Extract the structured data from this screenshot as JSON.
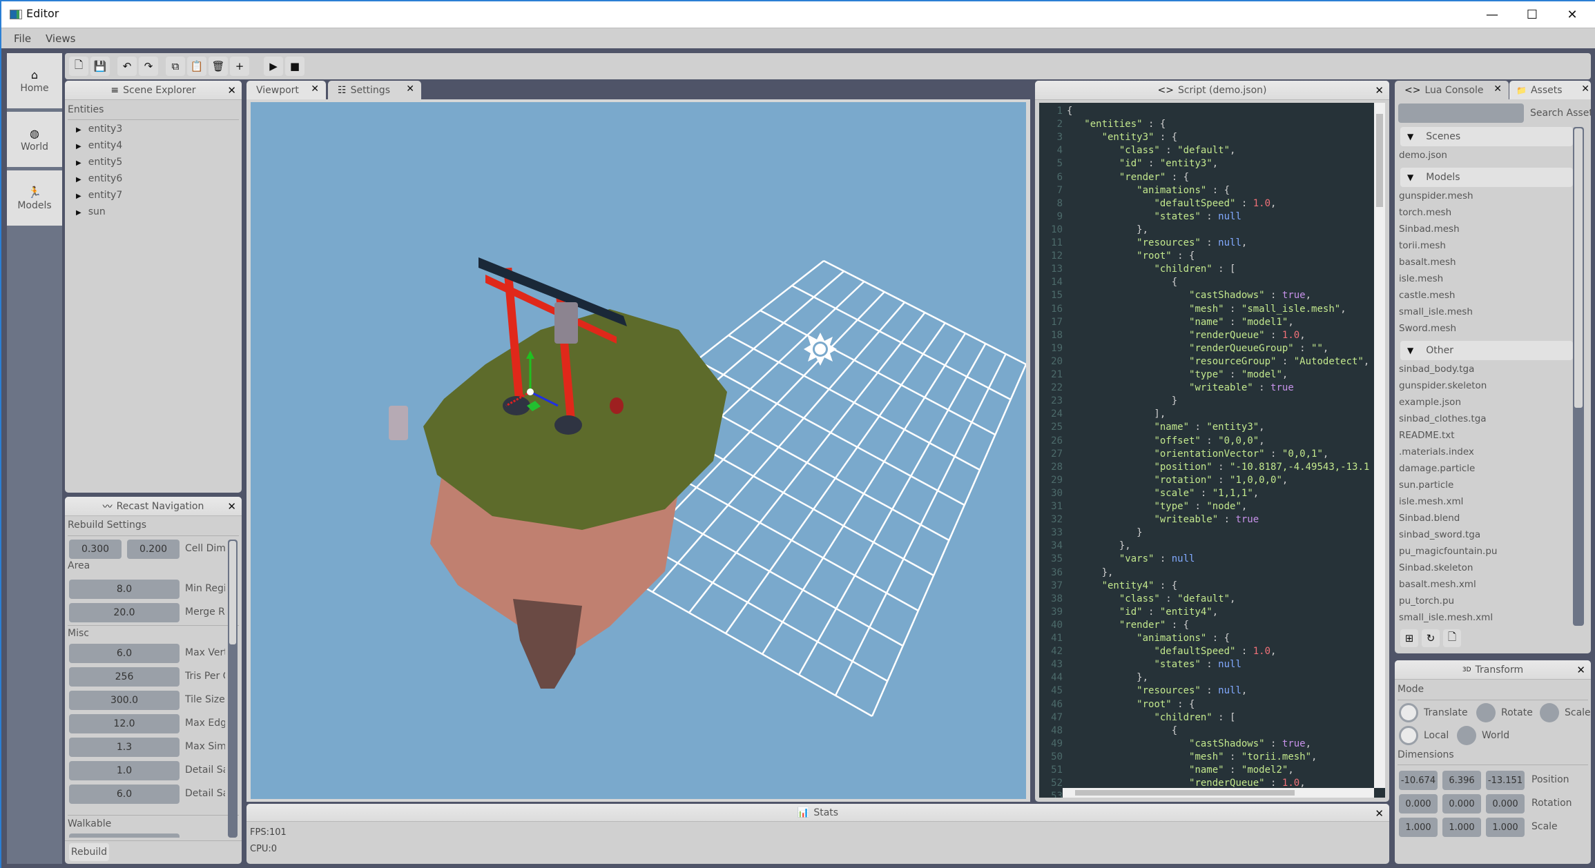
{
  "window": {
    "title": "Editor",
    "controls": {
      "minimize": "—",
      "maximize": "☐",
      "close": "✕"
    }
  },
  "menu": {
    "items": [
      "File",
      "Views"
    ]
  },
  "toolbar": {
    "buttons": [
      {
        "name": "new-file",
        "glyph": "🗋"
      },
      {
        "name": "save",
        "glyph": "💾"
      },
      {
        "name": "undo",
        "glyph": "↶"
      },
      {
        "name": "redo",
        "glyph": "↷"
      },
      {
        "name": "copy",
        "glyph": "⧉"
      },
      {
        "name": "paste",
        "glyph": "📋"
      },
      {
        "name": "delete",
        "glyph": "🗑"
      },
      {
        "name": "add",
        "glyph": "+"
      },
      {
        "name": "play",
        "glyph": "▶"
      },
      {
        "name": "stop",
        "glyph": "■"
      }
    ]
  },
  "sidebar": {
    "items": [
      {
        "label": "Home",
        "icon": "⌂"
      },
      {
        "label": "World",
        "icon": "◍"
      },
      {
        "label": "Models",
        "icon": "🏃"
      }
    ]
  },
  "scene_explorer": {
    "title": "Scene Explorer",
    "icon": "≡",
    "section": "Entities",
    "entities": [
      "entity3",
      "entity4",
      "entity5",
      "entity6",
      "entity7",
      "sun"
    ]
  },
  "recast": {
    "title": "Recast Navigation",
    "icon": "〰",
    "section": "Rebuild Settings",
    "cell_dimensions": {
      "values": [
        "0.300",
        "0.200"
      ],
      "label": "Cell Dimensions"
    },
    "area": {
      "label": "Area",
      "fields": [
        {
          "value": "8.0",
          "label": "Min Region"
        },
        {
          "value": "20.0",
          "label": "Merge Region"
        }
      ]
    },
    "misc": {
      "label": "Misc",
      "fields": [
        {
          "value": "6.0",
          "label": "Max Verts"
        },
        {
          "value": "256",
          "label": "Tris Per Chunk"
        },
        {
          "value": "300.0",
          "label": "Tile Size"
        },
        {
          "value": "12.0",
          "label": "Max Edge"
        },
        {
          "value": "1.3",
          "label": "Max Simplification"
        },
        {
          "value": "1.0",
          "label": "Detail Sample Dist"
        },
        {
          "value": "6.0",
          "label": "Detail Sample Max Error"
        }
      ]
    },
    "walkable": {
      "label": "Walkable"
    },
    "rebuild_button": "Rebuild"
  },
  "center_tabs": [
    {
      "label": "Viewport",
      "icon": "",
      "active": true
    },
    {
      "label": "Settings",
      "icon": "☷",
      "active": false
    }
  ],
  "viewport": {
    "sky_color": "#7aa9cc",
    "grid_color": "#ffffff",
    "gizmo_colors": {
      "x": "#e02020",
      "y": "#20c020",
      "z": "#2030e0"
    }
  },
  "stats": {
    "title": "Stats",
    "icon": "📊",
    "fps": "FPS:101",
    "cpu": "CPU:0"
  },
  "script": {
    "title": "Script (demo.json)",
    "icon": "<>",
    "lines": [
      [
        [
          "p",
          "{"
        ]
      ],
      [
        [
          "p",
          "   "
        ],
        [
          "k",
          "\"entities\""
        ],
        [
          "p",
          " : {"
        ]
      ],
      [
        [
          "p",
          "      "
        ],
        [
          "k",
          "\"entity3\""
        ],
        [
          "p",
          " : {"
        ]
      ],
      [
        [
          "p",
          "         "
        ],
        [
          "k",
          "\"class\""
        ],
        [
          "p",
          " : "
        ],
        [
          "s",
          "\"default\""
        ],
        [
          "p",
          ","
        ]
      ],
      [
        [
          "p",
          "         "
        ],
        [
          "k",
          "\"id\""
        ],
        [
          "p",
          " : "
        ],
        [
          "s",
          "\"entity3\""
        ],
        [
          "p",
          ","
        ]
      ],
      [
        [
          "p",
          "         "
        ],
        [
          "k",
          "\"render\""
        ],
        [
          "p",
          " : {"
        ]
      ],
      [
        [
          "p",
          "            "
        ],
        [
          "k",
          "\"animations\""
        ],
        [
          "p",
          " : {"
        ]
      ],
      [
        [
          "p",
          "               "
        ],
        [
          "k",
          "\"defaultSpeed\""
        ],
        [
          "p",
          " : "
        ],
        [
          "n",
          "1.0"
        ],
        [
          "p",
          ","
        ]
      ],
      [
        [
          "p",
          "               "
        ],
        [
          "k",
          "\"states\""
        ],
        [
          "p",
          " : "
        ],
        [
          "nl",
          "null"
        ]
      ],
      [
        [
          "p",
          "            },"
        ]
      ],
      [
        [
          "p",
          "            "
        ],
        [
          "k",
          "\"resources\""
        ],
        [
          "p",
          " : "
        ],
        [
          "nl",
          "null"
        ],
        [
          "p",
          ","
        ]
      ],
      [
        [
          "p",
          "            "
        ],
        [
          "k",
          "\"root\""
        ],
        [
          "p",
          " : {"
        ]
      ],
      [
        [
          "p",
          "               "
        ],
        [
          "k",
          "\"children\""
        ],
        [
          "p",
          " : ["
        ]
      ],
      [
        [
          "p",
          "                  {"
        ]
      ],
      [
        [
          "p",
          "                     "
        ],
        [
          "k",
          "\"castShadows\""
        ],
        [
          "p",
          " : "
        ],
        [
          "b",
          "true"
        ],
        [
          "p",
          ","
        ]
      ],
      [
        [
          "p",
          "                     "
        ],
        [
          "k",
          "\"mesh\""
        ],
        [
          "p",
          " : "
        ],
        [
          "s",
          "\"small_isle.mesh\""
        ],
        [
          "p",
          ","
        ]
      ],
      [
        [
          "p",
          "                     "
        ],
        [
          "k",
          "\"name\""
        ],
        [
          "p",
          " : "
        ],
        [
          "s",
          "\"model1\""
        ],
        [
          "p",
          ","
        ]
      ],
      [
        [
          "p",
          "                     "
        ],
        [
          "k",
          "\"renderQueue\""
        ],
        [
          "p",
          " : "
        ],
        [
          "n",
          "1.0"
        ],
        [
          "p",
          ","
        ]
      ],
      [
        [
          "p",
          "                     "
        ],
        [
          "k",
          "\"renderQueueGroup\""
        ],
        [
          "p",
          " : "
        ],
        [
          "s",
          "\"\""
        ],
        [
          "p",
          ","
        ]
      ],
      [
        [
          "p",
          "                     "
        ],
        [
          "k",
          "\"resourceGroup\""
        ],
        [
          "p",
          " : "
        ],
        [
          "s",
          "\"Autodetect\""
        ],
        [
          "p",
          ","
        ]
      ],
      [
        [
          "p",
          "                     "
        ],
        [
          "k",
          "\"type\""
        ],
        [
          "p",
          " : "
        ],
        [
          "s",
          "\"model\""
        ],
        [
          "p",
          ","
        ]
      ],
      [
        [
          "p",
          "                     "
        ],
        [
          "k",
          "\"writeable\""
        ],
        [
          "p",
          " : "
        ],
        [
          "b",
          "true"
        ]
      ],
      [
        [
          "p",
          "                  }"
        ]
      ],
      [
        [
          "p",
          "               ],"
        ]
      ],
      [
        [
          "p",
          "               "
        ],
        [
          "k",
          "\"name\""
        ],
        [
          "p",
          " : "
        ],
        [
          "s",
          "\"entity3\""
        ],
        [
          "p",
          ","
        ]
      ],
      [
        [
          "p",
          "               "
        ],
        [
          "k",
          "\"offset\""
        ],
        [
          "p",
          " : "
        ],
        [
          "s",
          "\"0,0,0\""
        ],
        [
          "p",
          ","
        ]
      ],
      [
        [
          "p",
          "               "
        ],
        [
          "k",
          "\"orientationVector\""
        ],
        [
          "p",
          " : "
        ],
        [
          "s",
          "\"0,0,1\""
        ],
        [
          "p",
          ","
        ]
      ],
      [
        [
          "p",
          "               "
        ],
        [
          "k",
          "\"position\""
        ],
        [
          "p",
          " : "
        ],
        [
          "s",
          "\"-10.8187,-4.49543,-13.1"
        ]
      ],
      [
        [
          "p",
          "               "
        ],
        [
          "k",
          "\"rotation\""
        ],
        [
          "p",
          " : "
        ],
        [
          "s",
          "\"1,0,0,0\""
        ],
        [
          "p",
          ","
        ]
      ],
      [
        [
          "p",
          "               "
        ],
        [
          "k",
          "\"scale\""
        ],
        [
          "p",
          " : "
        ],
        [
          "s",
          "\"1,1,1\""
        ],
        [
          "p",
          ","
        ]
      ],
      [
        [
          "p",
          "               "
        ],
        [
          "k",
          "\"type\""
        ],
        [
          "p",
          " : "
        ],
        [
          "s",
          "\"node\""
        ],
        [
          "p",
          ","
        ]
      ],
      [
        [
          "p",
          "               "
        ],
        [
          "k",
          "\"writeable\""
        ],
        [
          "p",
          " : "
        ],
        [
          "b",
          "true"
        ]
      ],
      [
        [
          "p",
          "            }"
        ]
      ],
      [
        [
          "p",
          "         },"
        ]
      ],
      [
        [
          "p",
          "         "
        ],
        [
          "k",
          "\"vars\""
        ],
        [
          "p",
          " : "
        ],
        [
          "nl",
          "null"
        ]
      ],
      [
        [
          "p",
          "      },"
        ]
      ],
      [
        [
          "p",
          "      "
        ],
        [
          "k",
          "\"entity4\""
        ],
        [
          "p",
          " : {"
        ]
      ],
      [
        [
          "p",
          "         "
        ],
        [
          "k",
          "\"class\""
        ],
        [
          "p",
          " : "
        ],
        [
          "s",
          "\"default\""
        ],
        [
          "p",
          ","
        ]
      ],
      [
        [
          "p",
          "         "
        ],
        [
          "k",
          "\"id\""
        ],
        [
          "p",
          " : "
        ],
        [
          "s",
          "\"entity4\""
        ],
        [
          "p",
          ","
        ]
      ],
      [
        [
          "p",
          "         "
        ],
        [
          "k",
          "\"render\""
        ],
        [
          "p",
          " : {"
        ]
      ],
      [
        [
          "p",
          "            "
        ],
        [
          "k",
          "\"animations\""
        ],
        [
          "p",
          " : {"
        ]
      ],
      [
        [
          "p",
          "               "
        ],
        [
          "k",
          "\"defaultSpeed\""
        ],
        [
          "p",
          " : "
        ],
        [
          "n",
          "1.0"
        ],
        [
          "p",
          ","
        ]
      ],
      [
        [
          "p",
          "               "
        ],
        [
          "k",
          "\"states\""
        ],
        [
          "p",
          " : "
        ],
        [
          "nl",
          "null"
        ]
      ],
      [
        [
          "p",
          "            },"
        ]
      ],
      [
        [
          "p",
          "            "
        ],
        [
          "k",
          "\"resources\""
        ],
        [
          "p",
          " : "
        ],
        [
          "nl",
          "null"
        ],
        [
          "p",
          ","
        ]
      ],
      [
        [
          "p",
          "            "
        ],
        [
          "k",
          "\"root\""
        ],
        [
          "p",
          " : {"
        ]
      ],
      [
        [
          "p",
          "               "
        ],
        [
          "k",
          "\"children\""
        ],
        [
          "p",
          " : ["
        ]
      ],
      [
        [
          "p",
          "                  {"
        ]
      ],
      [
        [
          "p",
          "                     "
        ],
        [
          "k",
          "\"castShadows\""
        ],
        [
          "p",
          " : "
        ],
        [
          "b",
          "true"
        ],
        [
          "p",
          ","
        ]
      ],
      [
        [
          "p",
          "                     "
        ],
        [
          "k",
          "\"mesh\""
        ],
        [
          "p",
          " : "
        ],
        [
          "s",
          "\"torii.mesh\""
        ],
        [
          "p",
          ","
        ]
      ],
      [
        [
          "p",
          "                     "
        ],
        [
          "k",
          "\"name\""
        ],
        [
          "p",
          " : "
        ],
        [
          "s",
          "\"model2\""
        ],
        [
          "p",
          ","
        ]
      ],
      [
        [
          "p",
          "                     "
        ],
        [
          "k",
          "\"renderQueue\""
        ],
        [
          "p",
          " : "
        ],
        [
          "n",
          "1.0"
        ],
        [
          "p",
          ","
        ]
      ],
      [
        [
          "p",
          ""
        ]
      ]
    ]
  },
  "right_tabs": [
    {
      "label": "Lua Console",
      "icon": "<>"
    },
    {
      "label": "Assets",
      "icon": "📁"
    }
  ],
  "assets": {
    "search_label": "Search Assets",
    "search_value": "",
    "groups": [
      {
        "name": "Scenes",
        "items": [
          "demo.json"
        ]
      },
      {
        "name": "Models",
        "items": [
          "gunspider.mesh",
          "torch.mesh",
          "Sinbad.mesh",
          "torii.mesh",
          "basalt.mesh",
          "isle.mesh",
          "castle.mesh",
          "small_isle.mesh",
          "Sword.mesh"
        ]
      },
      {
        "name": "Other",
        "items": [
          "sinbad_body.tga",
          "gunspider.skeleton",
          "example.json",
          "sinbad_clothes.tga",
          "README.txt",
          ".materials.index",
          "damage.particle",
          "sun.particle",
          "isle.mesh.xml",
          "Sinbad.blend",
          "sinbad_sword.tga",
          "pu_magicfountain.pu",
          "Sinbad.skeleton",
          "basalt.mesh.xml",
          "pu_torch.pu",
          "small_isle.mesh.xml"
        ]
      }
    ],
    "footer_buttons": [
      {
        "name": "add-asset",
        "glyph": "⊞"
      },
      {
        "name": "refresh",
        "glyph": "↻"
      },
      {
        "name": "new-file",
        "glyph": "🗋"
      }
    ]
  },
  "transform": {
    "title": "Transform",
    "icon": "3D",
    "mode_label": "Mode",
    "modes": [
      {
        "label": "Translate",
        "selected": true
      },
      {
        "label": "Rotate",
        "selected": false
      },
      {
        "label": "Scale",
        "selected": false
      }
    ],
    "spaces": [
      {
        "label": "Local",
        "selected": true
      },
      {
        "label": "World",
        "selected": false
      }
    ],
    "dimensions_label": "Dimensions",
    "rows": [
      {
        "label": "Position",
        "values": [
          "-10.674",
          "6.396",
          "-13.151"
        ]
      },
      {
        "label": "Rotation",
        "values": [
          "0.000",
          "0.000",
          "0.000"
        ]
      },
      {
        "label": "Scale",
        "values": [
          "1.000",
          "1.000",
          "1.000"
        ]
      }
    ]
  }
}
